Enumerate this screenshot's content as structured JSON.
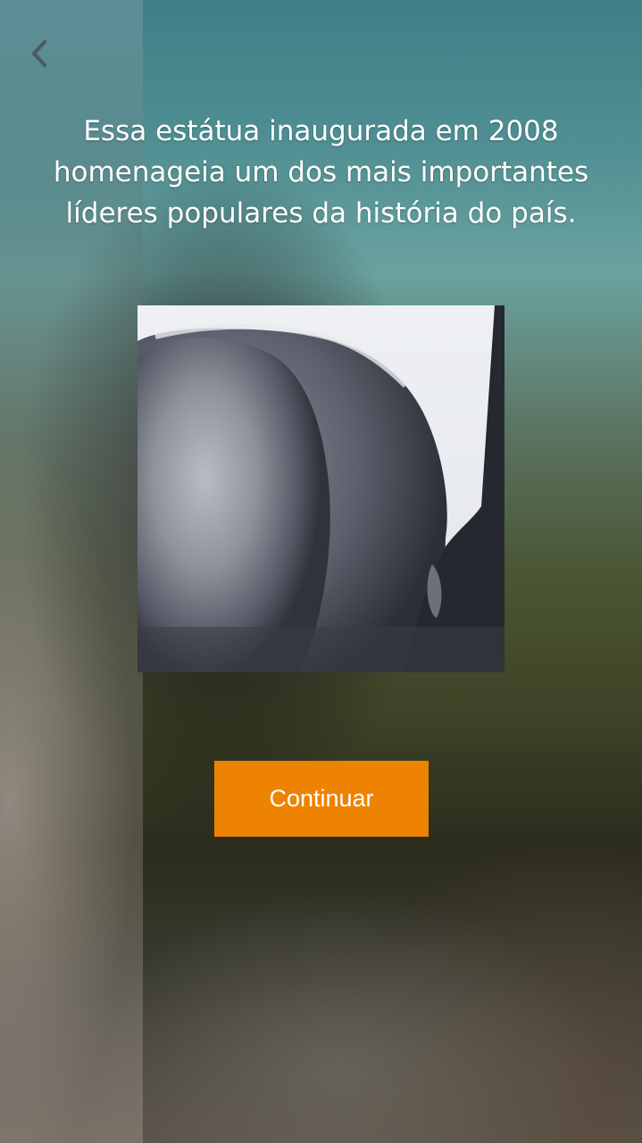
{
  "screen": {
    "caption_lines": [
      "Essa estátua inaugurada em 2008",
      "homenageia um dos mais importantes",
      "líderes populares da história do país."
    ],
    "continue_label": "Continuar",
    "back_icon": "chevron-left-icon",
    "accent_color": "#ee8302",
    "image_subject": "statue-closeup"
  }
}
